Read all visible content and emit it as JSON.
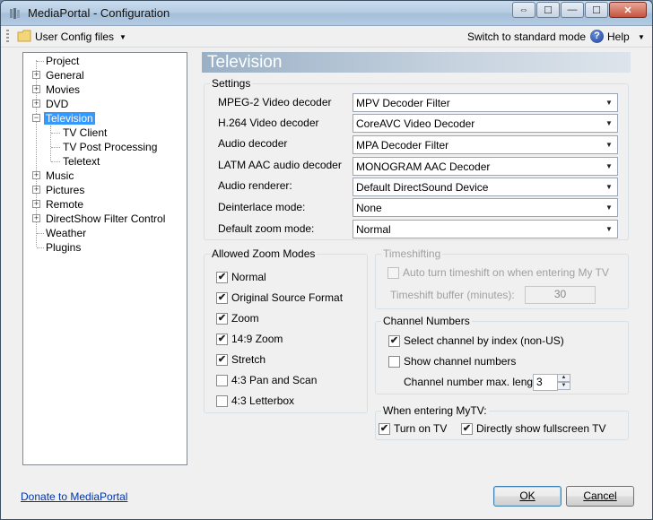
{
  "window": {
    "title": "MediaPortal - Configuration",
    "controls": {
      "help": "⇔",
      "minimize": "—",
      "maximize": "☐",
      "close": "✕"
    }
  },
  "toolbar": {
    "config_files": "User Config files",
    "switch_mode": "Switch to standard mode",
    "help_label": "Help",
    "help_icon": "?"
  },
  "tree": {
    "items": [
      {
        "label": "Project",
        "expander": ""
      },
      {
        "label": "General",
        "expander": "+"
      },
      {
        "label": "Movies",
        "expander": "+"
      },
      {
        "label": "DVD",
        "expander": "+"
      },
      {
        "label": "Television",
        "expander": "−",
        "selected": true
      },
      {
        "label": "TV Client",
        "child": true
      },
      {
        "label": "TV Post Processing",
        "child": true
      },
      {
        "label": "Teletext",
        "child": true
      },
      {
        "label": "Music",
        "expander": "+"
      },
      {
        "label": "Pictures",
        "expander": "+"
      },
      {
        "label": "Remote",
        "expander": "+"
      },
      {
        "label": "DirectShow Filter Control",
        "expander": "+"
      },
      {
        "label": "Weather",
        "expander": ""
      },
      {
        "label": "Plugins",
        "expander": ""
      }
    ]
  },
  "section_title": "Television",
  "settings": {
    "group_title": "Settings",
    "rows": [
      {
        "label": "MPEG-2 Video decoder",
        "value": "MPV Decoder Filter"
      },
      {
        "label": "H.264 Video decoder",
        "value": "CoreAVC Video Decoder"
      },
      {
        "label": "Audio decoder",
        "value": "MPA Decoder Filter"
      },
      {
        "label": "LATM AAC audio decoder",
        "value": "MONOGRAM AAC Decoder"
      },
      {
        "label": "Audio renderer:",
        "value": "Default DirectSound Device"
      },
      {
        "label": "Deinterlace mode:",
        "value": "None"
      },
      {
        "label": "Default zoom mode:",
        "value": "Normal"
      }
    ]
  },
  "zoom": {
    "group_title": "Allowed Zoom Modes",
    "items": [
      {
        "label": "Normal",
        "checked": true
      },
      {
        "label": "Original Source Format",
        "checked": true
      },
      {
        "label": "Zoom",
        "checked": true
      },
      {
        "label": "14:9 Zoom",
        "checked": true
      },
      {
        "label": "Stretch",
        "checked": true
      },
      {
        "label": "4:3 Pan and Scan",
        "checked": false
      },
      {
        "label": "4:3 Letterbox",
        "checked": false
      }
    ]
  },
  "timeshifting": {
    "group_title": "Timeshifting",
    "auto_label": "Auto turn timeshift on when entering My TV",
    "buffer_label": "Timeshift buffer (minutes):",
    "buffer_value": "30"
  },
  "channel_numbers": {
    "group_title": "Channel Numbers",
    "select_by_index": "Select channel by index (non-US)",
    "show_numbers": "Show channel numbers",
    "max_length_label": "Channel number max. length",
    "max_length_value": "3"
  },
  "entering_mytv": {
    "group_title": "When entering MyTV:",
    "turn_on_tv": "Turn on TV",
    "fullscreen": "Directly show fullscreen TV"
  },
  "footer": {
    "donate_link": "Donate to MediaPortal",
    "ok": "OK",
    "cancel": "Cancel"
  },
  "colors": {
    "selection": "#3399ff",
    "header_band": "#9ab0c6",
    "link": "#0033aa"
  }
}
